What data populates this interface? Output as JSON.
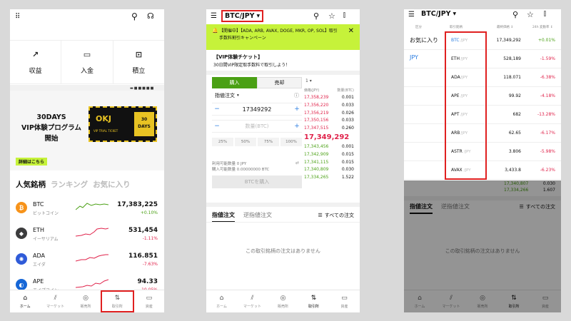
{
  "s1": {
    "quick": [
      {
        "label": "収益",
        "icon": "chart-up-icon"
      },
      {
        "label": "入金",
        "icon": "wallet-icon"
      },
      {
        "label": "積立",
        "icon": "calendar-icon"
      }
    ],
    "banner": {
      "title": "30DAYS\nVIP体験プログラム\n開始",
      "detail": "詳細はこちら",
      "ticket_brand": "OKJ",
      "ticket_text": "VIP TRIAL TICKET",
      "ticket_days": "30\nDAYS"
    },
    "tabs": [
      "人気銘柄",
      "ランキング",
      "お気に入り"
    ],
    "coins": [
      {
        "sym": "BTC",
        "name": "ビットコイン",
        "price": "17,383,225",
        "chg": "+0.10%",
        "up": true,
        "color": "#f7931a",
        "glyph": "₿"
      },
      {
        "sym": "ETH",
        "name": "イーサリアム",
        "price": "531,454",
        "chg": "-1.11%",
        "up": false,
        "color": "#3c3c3d",
        "glyph": "◆"
      },
      {
        "sym": "ADA",
        "name": "エイダ",
        "price": "116.851",
        "chg": "-7.63%",
        "up": false,
        "color": "#2f5bd8",
        "glyph": "✺"
      },
      {
        "sym": "APE",
        "name": "エイプコイン",
        "price": "94.33",
        "chg": "-10.05%",
        "up": false,
        "color": "#1566d6",
        "glyph": "◐"
      }
    ]
  },
  "nav": [
    "ホーム",
    "マーケット",
    "販売所",
    "取引所",
    "資産"
  ],
  "s2": {
    "pair": "BTC/JPY",
    "notice": "【開催中】【ADA, ARB, AVAX, DOGE, MKR, OP, SOL】取引手数料割引キャンペーン",
    "vip_title": "【VIP体験チケット】",
    "vip_sub": "30日間VIP限定取手数料で取引しよう！",
    "buy": "購入",
    "sell": "売却",
    "qty_sel": "1",
    "order_type": "指値注文",
    "price_value": "17349292",
    "qty_placeholder": "数量(BTC)",
    "pcts": [
      "25%",
      "50%",
      "75%",
      "100%"
    ],
    "avail_jpy": "利用可能数量 0 JPY",
    "avail_btc": "購入可能数量 0.00000000 BTC",
    "submit": "BTCを購入",
    "ob_h1": "価格(JPY)",
    "ob_h2": "数量(BTC)",
    "asks": [
      [
        "17,358,239",
        "0.001"
      ],
      [
        "17,356,220",
        "0.033"
      ],
      [
        "17,356,219",
        "0.026"
      ],
      [
        "17,350,156",
        "0.033"
      ],
      [
        "17,347,515",
        "0.260"
      ]
    ],
    "last": "17,349,292",
    "bids": [
      [
        "17,343,456",
        "0.001"
      ],
      [
        "17,342,909",
        "0.015"
      ],
      [
        "17,341,115",
        "0.015"
      ],
      [
        "17,340,809",
        "0.030"
      ],
      [
        "17,334,265",
        "1.522"
      ]
    ],
    "otab1": "指値注文",
    "otab2": "逆指値注文",
    "all_orders": "すべての注文",
    "empty": "この取引銘柄の注文はありません"
  },
  "s3": {
    "pair": "BTC/JPY",
    "h1": "区分",
    "h2": "取引銘柄",
    "h3": "最終価格 ↕",
    "h4": "24h 変動率 ↕",
    "cats": [
      "お気に入り",
      "JPY"
    ],
    "pairs": [
      {
        "b": "BTC",
        "q": "/JPY",
        "p": "17,349,292",
        "c": "+0.01%",
        "up": true
      },
      {
        "b": "ETH",
        "q": "/JPY",
        "p": "528,189",
        "c": "-1.59%",
        "up": false
      },
      {
        "b": "ADA",
        "q": "/JPY",
        "p": "118.071",
        "c": "-6.38%",
        "up": false
      },
      {
        "b": "APE",
        "q": "/JPY",
        "p": "99.92",
        "c": "-4.18%",
        "up": false
      },
      {
        "b": "APT",
        "q": "/JPY",
        "p": "682",
        "c": "-13.28%",
        "up": false
      },
      {
        "b": "ARB",
        "q": "/JPY",
        "p": "62.65",
        "c": "-6.17%",
        "up": false
      },
      {
        "b": "ASTR",
        "q": "/JPY",
        "p": "3.806",
        "c": "-5.98%",
        "up": false
      },
      {
        "b": "AVAX",
        "q": "/JPY",
        "p": "3,433.8",
        "c": "-6.23%",
        "up": false
      }
    ],
    "under": [
      [
        "17,340,807",
        "0.030"
      ],
      [
        "17,334,266",
        "1.607"
      ]
    ],
    "otab1": "指値注文",
    "otab2": "逆指値注文",
    "all_orders": "すべての注文",
    "empty": "この取引銘柄の注文はありません"
  },
  "colors": {
    "accent": "#4aa014",
    "notice": "#c6f23a",
    "up": "#4aa014",
    "down": "#e0224a",
    "highlight": "#e02020"
  }
}
